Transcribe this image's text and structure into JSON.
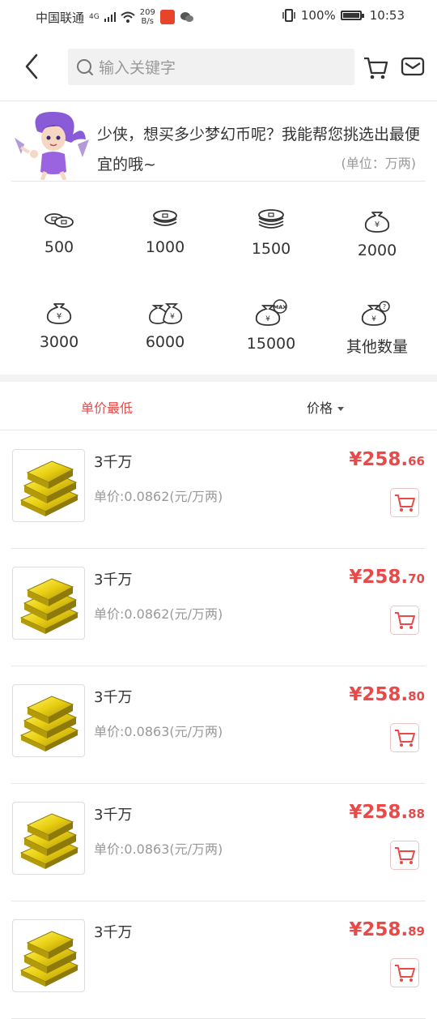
{
  "status_bar": {
    "carrier": "中国联通",
    "net_type": "4G",
    "net_speed_value": "209",
    "net_speed_unit": "B/s",
    "battery": "100%",
    "time": "10:53"
  },
  "header": {
    "search_placeholder": "输入关键字"
  },
  "banner": {
    "message": "少侠，想买多少梦幻币呢？我能帮您挑选出最便宜的哦~",
    "unit": "(单位：万两)"
  },
  "amounts": [
    {
      "label": "500",
      "icon": "coins-small-icon"
    },
    {
      "label": "1000",
      "icon": "coins-stack-icon"
    },
    {
      "label": "1500",
      "icon": "coins-large-icon"
    },
    {
      "label": "2000",
      "icon": "money-bag-icon"
    },
    {
      "label": "3000",
      "icon": "money-bag-icon"
    },
    {
      "label": "6000",
      "icon": "money-bags-icon"
    },
    {
      "label": "15000",
      "icon": "money-bag-max-icon"
    },
    {
      "label": "其他数量",
      "icon": "money-bag-question-icon"
    }
  ],
  "sort": {
    "lowest_unit": "单价最低",
    "price": "价格"
  },
  "listings": [
    {
      "name": "3千万",
      "unit_price": "单价:0.0862(元/万两)",
      "price_main": "¥258.",
      "price_cents": "66"
    },
    {
      "name": "3千万",
      "unit_price": "单价:0.0862(元/万两)",
      "price_main": "¥258.",
      "price_cents": "70"
    },
    {
      "name": "3千万",
      "unit_price": "单价:0.0863(元/万两)",
      "price_main": "¥258.",
      "price_cents": "80"
    },
    {
      "name": "3千万",
      "unit_price": "单价:0.0863(元/万两)",
      "price_main": "¥258.",
      "price_cents": "88"
    },
    {
      "name": "3千万",
      "unit_price": "",
      "price_main": "¥258.",
      "price_cents": "89"
    }
  ],
  "colors": {
    "accent": "#e84a4a",
    "muted": "#999999",
    "text": "#333333"
  }
}
